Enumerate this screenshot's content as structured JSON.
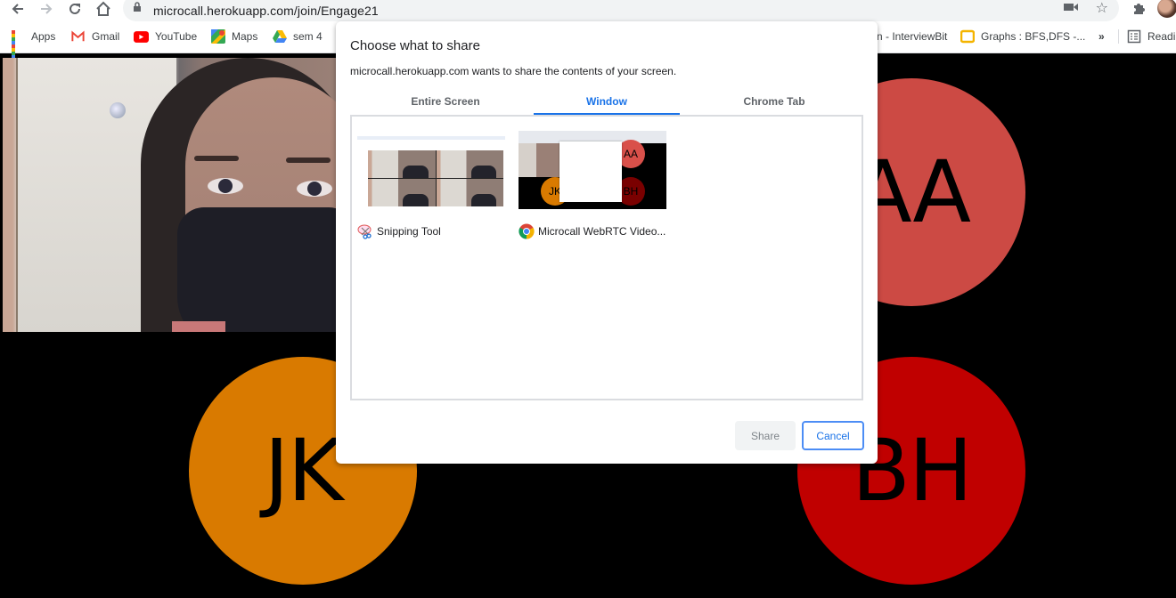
{
  "browser": {
    "url": "microcall.herokuapp.com/join/Engage21",
    "nav": {
      "back_icon": "arrow-left",
      "forward_icon": "arrow-right",
      "reload_icon": "reload",
      "home_icon": "home"
    },
    "omnibox_icons": [
      "lock-icon",
      "camera-icon",
      "star-icon"
    ],
    "bookmarks": [
      {
        "label": "Apps",
        "icon": "apps-grid-icon"
      },
      {
        "label": "Gmail",
        "icon": "gmail-icon"
      },
      {
        "label": "YouTube",
        "icon": "youtube-icon"
      },
      {
        "label": "Maps",
        "icon": "maps-icon"
      },
      {
        "label": "sem 4",
        "icon": "google-drive-icon"
      },
      {
        "label": "n - InterviewBit",
        "icon": ""
      },
      {
        "label": "Graphs : BFS,DFS -...",
        "icon": "google-slides-icon"
      }
    ],
    "overflow_label": "»",
    "reading_list_label": "Readin"
  },
  "call": {
    "participants": [
      {
        "initials": "AA",
        "color": "#cc4a44"
      },
      {
        "initials": "JK",
        "color": "#d97a00"
      },
      {
        "initials": "BH",
        "color": "#c00000"
      }
    ]
  },
  "dialog": {
    "title": "Choose what to share",
    "subtitle": "microcall.herokuapp.com wants to share the contents of your screen.",
    "tabs": [
      {
        "label": "Entire Screen",
        "active": false
      },
      {
        "label": "Window",
        "active": true
      },
      {
        "label": "Chrome Tab",
        "active": false
      }
    ],
    "sources": [
      {
        "label": "Snipping Tool",
        "icon": "snipping-tool-icon"
      },
      {
        "label": "Microcall WebRTC Video...",
        "icon": "chrome-icon"
      }
    ],
    "thumb_avatars": [
      "AA",
      "JK",
      "BH"
    ],
    "buttons": {
      "share": "Share",
      "cancel": "Cancel"
    },
    "accent_color": "#1a73e8"
  }
}
